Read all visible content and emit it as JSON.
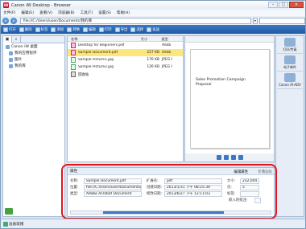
{
  "window": {
    "title": "Canon iW Desktop - Browser",
    "brand_color": "#c8102e"
  },
  "menu": [
    "文件(F)",
    "编辑(E)",
    "查看(V)",
    "浏览器(B)",
    "工具(T)",
    "设置(S)",
    "帮助(H)"
  ],
  "address": {
    "path": "file://C:/Users/user/Documents/我的库",
    "search_placeholder": ""
  },
  "toolbar": {
    "buttons": [
      "打开",
      "删除",
      "标签",
      "添加",
      "转换",
      "编辑",
      "打印",
      "导出",
      "选择",
      "发送"
    ]
  },
  "tree": [
    {
      "label": "Canon iW 桌面",
      "icon": "desktop-icon"
    },
    {
      "label": "我的应用程序",
      "icon": "folder-icon"
    },
    {
      "label": "图片",
      "icon": "folder-icon"
    },
    {
      "label": "我的库",
      "icon": "library-icon"
    }
  ],
  "file_list": {
    "headers": [
      "名称",
      "大小",
      "类型"
    ],
    "rows": [
      {
        "name": "Desktop for Beginners.pdf",
        "size": "",
        "type": "Adob",
        "icon": "pdf",
        "selected": false
      },
      {
        "name": "Sample Document.pdf",
        "size": "227 KB",
        "type": "Adob",
        "icon": "pdf",
        "selected": true
      },
      {
        "name": "Sample Picture1.jpg",
        "size": "176 KB",
        "type": "JPEG I",
        "icon": "img",
        "selected": false
      },
      {
        "name": "Sample Picture2.jpg",
        "size": "126 KB",
        "type": "JPEG I",
        "icon": "img",
        "selected": false
      },
      {
        "name": "回收站",
        "size": "",
        "type": "",
        "icon": "trash",
        "selected": false
      }
    ]
  },
  "preview": {
    "doc_title": "Sales Promotion Campaign Proposal"
  },
  "right_panel": [
    "打印/传真",
    "电子邮件",
    "Canon iR-ADV"
  ],
  "properties": {
    "header": "属性",
    "edit": "编辑属性",
    "close": "折叠面板",
    "name_label": "名称:",
    "name_value": "Sample Document.pdf",
    "location_label": "位置:",
    "location_value": "file://C:/Users/user/Documents/我",
    "type_label": "类型:",
    "type_value": "Adobe Acrobat Document",
    "ext_label": "扩展名:",
    "ext_value": "pdf",
    "created_label": "创建日期:",
    "created_value": "2013/1/31 下午 08:25:39",
    "modified_label": "修改日期:",
    "modified_value": "2013/6/27 下午 12:11:03",
    "size_label": "大小:",
    "size_value": "232,004",
    "pages_label": "页:",
    "pages_value": "5",
    "tags_label": "标签:",
    "tags_value": "",
    "embedded_label": "嵌入的批注:",
    "embedded_value": ""
  },
  "status": {
    "text": "准备就绪"
  },
  "highlight_color": "#e0171f"
}
